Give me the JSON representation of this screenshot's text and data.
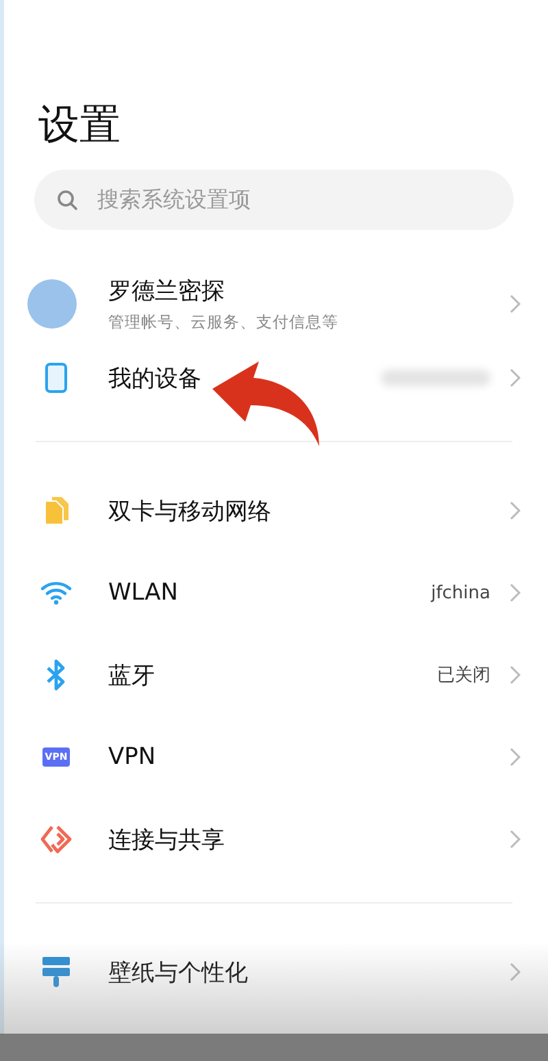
{
  "title": "设置",
  "search": {
    "placeholder": "搜索系统设置项"
  },
  "account": {
    "name": "罗德兰密探",
    "subtitle": "管理帐号、云服务、支付信息等"
  },
  "sections": [
    {
      "items": [
        {
          "label": "我的设备",
          "value_blurred": true
        }
      ]
    },
    {
      "items": [
        {
          "label": "双卡与移动网络"
        },
        {
          "label": "WLAN",
          "value": "jfchina"
        },
        {
          "label": "蓝牙",
          "value": "已关闭"
        },
        {
          "label": "VPN",
          "badge": "VPN"
        },
        {
          "label": "连接与共享"
        }
      ]
    },
    {
      "items": [
        {
          "label": "壁纸与个性化"
        }
      ]
    }
  ]
}
